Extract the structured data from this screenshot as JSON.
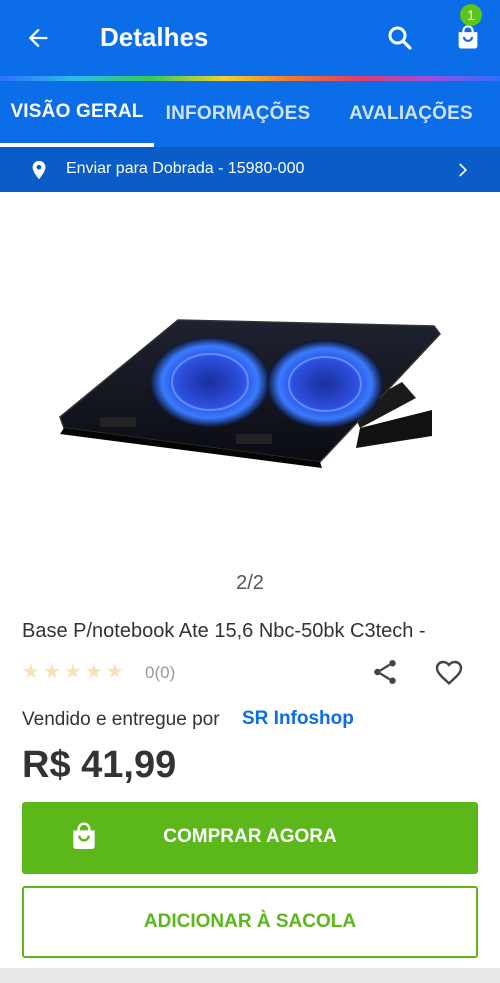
{
  "header": {
    "title": "Detalhes",
    "cart_count": "1",
    "icons": [
      "arrow-left-icon",
      "search-icon",
      "shopping-bag-icon"
    ]
  },
  "tabs": [
    {
      "label": "VISÃO GERAL",
      "active": true
    },
    {
      "label": "INFORMAÇÕES",
      "active": false
    },
    {
      "label": "AVALIAÇÕES",
      "active": false
    }
  ],
  "shipping": {
    "text": "Enviar para Dobrada - 15980-000"
  },
  "gallery": {
    "pager": "2/2"
  },
  "product": {
    "title": "Base P/notebook Ate 15,6 Nbc-50bk C3tech -",
    "rating": 0,
    "rating_text": "0(0)",
    "seller_prefix": "Vendido e entregue por",
    "seller_name": "SR Infoshop",
    "price": "R$ 41,99"
  },
  "actions": {
    "buy_label": "COMPRAR AGORA",
    "add_label": "ADICIONAR À SACOLA"
  },
  "colors": {
    "primary": "#0b6de8",
    "accent_green": "#5cb71a",
    "badge_green": "#5cc51a"
  }
}
